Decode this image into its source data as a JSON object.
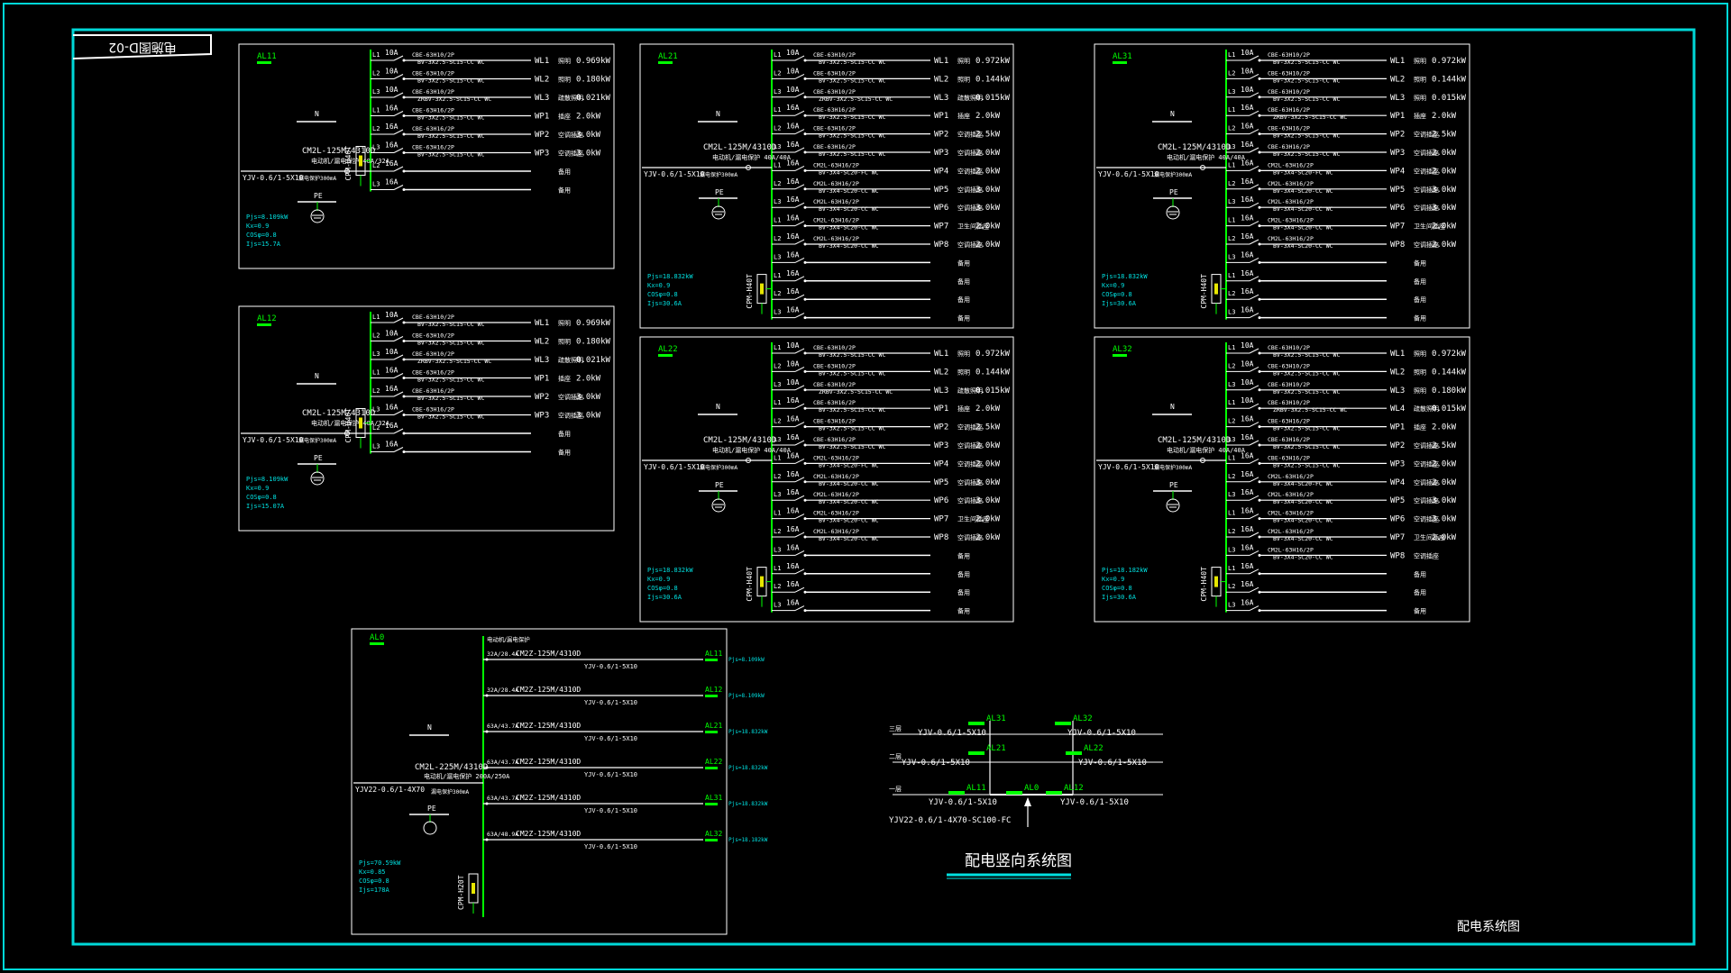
{
  "drawing_id": "电施图D-02",
  "sheet_name": "配电系统图",
  "riser": {
    "title": "配电竖向系统图",
    "floors": [
      "三层",
      "二层",
      "一层"
    ],
    "top_left": {
      "panel": "AL31",
      "cable": "YJV-0.6/1-5X10"
    },
    "top_right": {
      "panel": "AL32",
      "cable": "YJV-0.6/1-5X10"
    },
    "mid_left": {
      "panel": "AL21",
      "cable": "YJV-0.6/1-5X10"
    },
    "mid_right": {
      "panel": "AL22",
      "cable": "YJV-0.6/1-5X10"
    },
    "bot_left": {
      "panel": "AL11",
      "cable": "YJV-0.6/1-5X10"
    },
    "bot_center": {
      "panel": "AL0"
    },
    "bot_right": {
      "panel": "AL12",
      "cable": "YJV-0.6/1-5X10"
    },
    "incoming": "YJV22-0.6/1-4X70-SC100-FC"
  },
  "al0": {
    "name": "AL0",
    "n_label": "N",
    "pe_label": "PE",
    "main_breaker": "CM2L-225M/4310D",
    "main_breaker_spec": "电动机/漏电保护 200A/250A",
    "incoming": "YJV22-0.6/1-4X70",
    "rcd": "漏电保护300mA",
    "spd": "CPM-H20T",
    "pjs": "Pjs=70.59kW",
    "kx": "Kx=0.85",
    "cos": "COSφ=0.8",
    "ijs": "Ijs=178A",
    "header": "电动机/漏电保护",
    "rows": [
      {
        "rating": "32A/28.4A",
        "breaker": "CM2Z-125M/4310D",
        "cable": "YJV-0.6/1-5X10",
        "panel": "AL11",
        "pjs": "Pjs=8.109kW"
      },
      {
        "rating": "32A/28.4A",
        "breaker": "CM2Z-125M/4310D",
        "cable": "YJV-0.6/1-5X10",
        "panel": "AL12",
        "pjs": "Pjs=8.109kW"
      },
      {
        "rating": "63A/43.7A",
        "breaker": "CM2Z-125M/4310D",
        "cable": "YJV-0.6/1-5X10",
        "panel": "AL21",
        "pjs": "Pjs=18.832kW"
      },
      {
        "rating": "63A/43.7A",
        "breaker": "CM2Z-125M/4310D",
        "cable": "YJV-0.6/1-5X10",
        "panel": "AL22",
        "pjs": "Pjs=18.832kW"
      },
      {
        "rating": "63A/43.7A",
        "breaker": "CM2Z-125M/4310D",
        "cable": "YJV-0.6/1-5X10",
        "panel": "AL31",
        "pjs": "Pjs=18.832kW"
      },
      {
        "rating": "63A/48.9A",
        "breaker": "CM2Z-125M/4310D",
        "cable": "YJV-0.6/1-5X10",
        "panel": "AL32",
        "pjs": "Pjs=18.182kW"
      }
    ]
  },
  "panels": [
    {
      "name": "AL11",
      "n_label": "N",
      "pe_label": "PE",
      "main_breaker": "CM2L-125M/4310D",
      "main_breaker_spec": "电动机/漏电保护 40A/32A",
      "incoming": "YJV-0.6/1-5X10",
      "rcd": "漏电保护300mA",
      "spd": "CPM-H40T",
      "pjs": "Pjs=8.109kW",
      "kx": "Kx=0.9",
      "cos": "COSφ=0.8",
      "ijs": "Ijs=15.7A",
      "circuits": [
        {
          "ph": "L1",
          "amp": "10A",
          "brk": "CBE-63H10/2P",
          "cable": "BV-3X2.5-SC15-CC WC",
          "id": "WL1",
          "use": "照明",
          "kw": "0.969kW"
        },
        {
          "ph": "L2",
          "amp": "10A",
          "brk": "CBE-63H10/2P",
          "cable": "BV-3X2.5-SC15-CC WC",
          "id": "WL2",
          "use": "照明",
          "kw": "0.180kW"
        },
        {
          "ph": "L3",
          "amp": "10A",
          "brk": "CBE-63H10/2P",
          "cable": "ZRBV-3X2.5-SC15-CC WC",
          "id": "WL3",
          "use": "疏散照明",
          "kw": "0.021kW"
        },
        {
          "ph": "L1",
          "amp": "16A",
          "brk": "CBE-63H16/2P",
          "cable": "BV-3X2.5-SC15-CC WC",
          "id": "WP1",
          "use": "插座",
          "kw": "2.0kW"
        },
        {
          "ph": "L2",
          "amp": "16A",
          "brk": "CBE-63H16/2P",
          "cable": "BV-3X2.5-SC15-CC WC",
          "id": "WP2",
          "use": "空调插座",
          "kw": "3.0kW"
        },
        {
          "ph": "L3",
          "amp": "16A",
          "brk": "CBE-63H16/2P",
          "cable": "BV-3X2.5-SC15-CC WC",
          "id": "WP3",
          "use": "空调插座",
          "kw": "3.0kW"
        },
        {
          "ph": "L2",
          "amp": "16A",
          "brk": "",
          "cable": "",
          "id": "",
          "use": "备用",
          "kw": ""
        },
        {
          "ph": "L3",
          "amp": "16A",
          "brk": "",
          "cable": "",
          "id": "",
          "use": "备用",
          "kw": ""
        }
      ]
    },
    {
      "name": "AL12",
      "n_label": "N",
      "pe_label": "PE",
      "main_breaker": "CM2L-125M/4310D",
      "main_breaker_spec": "电动机/漏电保护 40A/32A",
      "incoming": "YJV-0.6/1-5X10",
      "rcd": "漏电保护300mA",
      "spd": "CPM-H40T",
      "pjs": "Pjs=8.109kW",
      "kx": "Kx=0.9",
      "cos": "COSφ=0.8",
      "ijs": "Ijs=15.07A",
      "circuits": [
        {
          "ph": "L1",
          "amp": "10A",
          "brk": "CBE-63H10/2P",
          "cable": "BV-3X2.5-SC15-CC WC",
          "id": "WL1",
          "use": "照明",
          "kw": "0.969kW"
        },
        {
          "ph": "L2",
          "amp": "10A",
          "brk": "CBE-63H10/2P",
          "cable": "BV-3X2.5-SC15-CC WC",
          "id": "WL2",
          "use": "照明",
          "kw": "0.180kW"
        },
        {
          "ph": "L3",
          "amp": "10A",
          "brk": "CBE-63H10/2P",
          "cable": "ZRBV-3X2.5-SC15-CC WC",
          "id": "WL3",
          "use": "疏散照明",
          "kw": "0.021kW"
        },
        {
          "ph": "L1",
          "amp": "16A",
          "brk": "CBE-63H16/2P",
          "cable": "BV-3X2.5-SC15-CC WC",
          "id": "WP1",
          "use": "插座",
          "kw": "2.0kW"
        },
        {
          "ph": "L2",
          "amp": "16A",
          "brk": "CBE-63H16/2P",
          "cable": "BV-3X2.5-SC15-CC WC",
          "id": "WP2",
          "use": "空调插座",
          "kw": "3.0kW"
        },
        {
          "ph": "L3",
          "amp": "16A",
          "brk": "CBE-63H16/2P",
          "cable": "BV-3X2.5-SC15-CC WC",
          "id": "WP3",
          "use": "空调插座",
          "kw": "3.0kW"
        },
        {
          "ph": "L2",
          "amp": "16A",
          "brk": "",
          "cable": "",
          "id": "",
          "use": "备用",
          "kw": ""
        },
        {
          "ph": "L3",
          "amp": "16A",
          "brk": "",
          "cable": "",
          "id": "",
          "use": "备用",
          "kw": ""
        }
      ]
    },
    {
      "name": "AL21",
      "n_label": "N",
      "pe_label": "PE",
      "main_breaker": "CM2L-125M/4310D",
      "main_breaker_spec": "电动机/漏电保护 40A/40A",
      "incoming": "YJV-0.6/1-5X10",
      "rcd": "漏电保护300mA",
      "spd": "CPM-H40T",
      "pjs": "Pjs=18.832kW",
      "kx": "Kx=0.9",
      "cos": "COSφ=0.8",
      "ijs": "Ijs=30.6A",
      "circuits": [
        {
          "ph": "L1",
          "amp": "10A",
          "brk": "CBE-63H10/2P",
          "cable": "BV-3X2.5-SC15-CC WC",
          "id": "WL1",
          "use": "照明",
          "kw": "0.972kW"
        },
        {
          "ph": "L2",
          "amp": "10A",
          "brk": "CBE-63H10/2P",
          "cable": "BV-3X2.5-SC15-CC WC",
          "id": "WL2",
          "use": "照明",
          "kw": "0.144kW"
        },
        {
          "ph": "L3",
          "amp": "10A",
          "brk": "CBE-63H10/2P",
          "cable": "ZRBV-3X2.5-SC15-CC WC",
          "id": "WL3",
          "use": "疏散照明",
          "kw": "0.015kW"
        },
        {
          "ph": "L1",
          "amp": "16A",
          "brk": "CBE-63H16/2P",
          "cable": "BV-3X2.5-SC15-CC WC",
          "id": "WP1",
          "use": "插座",
          "kw": "2.0kW"
        },
        {
          "ph": "L2",
          "amp": "16A",
          "brk": "CBE-63H16/2P",
          "cable": "BV-3X2.5-SC15-CC WC",
          "id": "WP2",
          "use": "空调插座",
          "kw": "2.5kW"
        },
        {
          "ph": "L3",
          "amp": "16A",
          "brk": "CBE-63H16/2P",
          "cable": "BV-3X2.5-SC15-CC WC",
          "id": "WP3",
          "use": "空调插座",
          "kw": "2.0kW"
        },
        {
          "ph": "L1",
          "amp": "16A",
          "brk": "CM2L-63H16/2P",
          "cable": "BV-3X4-SC20-FC WC",
          "id": "WP4",
          "use": "空调插座",
          "kw": "2.0kW"
        },
        {
          "ph": "L2",
          "amp": "16A",
          "brk": "CM2L-63H16/2P",
          "cable": "BV-3X4-SC20-CC WC",
          "id": "WP5",
          "use": "空调插座",
          "kw": "3.0kW"
        },
        {
          "ph": "L3",
          "amp": "16A",
          "brk": "CM2L-63H16/2P",
          "cable": "BV-3X4-SC20-CC WC",
          "id": "WP6",
          "use": "空调插座",
          "kw": "3.0kW"
        },
        {
          "ph": "L1",
          "amp": "16A",
          "brk": "CM2L-63H16/2P",
          "cable": "BV-3X4-SC20-CC WC",
          "id": "WP7",
          "use": "卫生间插座",
          "kw": "2.0kW"
        },
        {
          "ph": "L2",
          "amp": "16A",
          "brk": "CM2L-63H16/2P",
          "cable": "BV-3X4-SC20-CC WC",
          "id": "WP8",
          "use": "空调插座",
          "kw": "2.0kW"
        },
        {
          "ph": "L3",
          "amp": "16A",
          "brk": "",
          "cable": "",
          "id": "",
          "use": "备用",
          "kw": ""
        },
        {
          "ph": "L1",
          "amp": "16A",
          "brk": "",
          "cable": "",
          "id": "",
          "use": "备用",
          "kw": ""
        },
        {
          "ph": "L2",
          "amp": "16A",
          "brk": "",
          "cable": "",
          "id": "",
          "use": "备用",
          "kw": ""
        },
        {
          "ph": "L3",
          "amp": "16A",
          "brk": "",
          "cable": "",
          "id": "",
          "use": "备用",
          "kw": ""
        }
      ]
    },
    {
      "name": "AL22",
      "n_label": "N",
      "pe_label": "PE",
      "main_breaker": "CM2L-125M/4310D",
      "main_breaker_spec": "电动机/漏电保护 40A/40A",
      "incoming": "YJV-0.6/1-5X10",
      "rcd": "漏电保护300mA",
      "spd": "CPM-H40T",
      "pjs": "Pjs=18.832kW",
      "kx": "Kx=0.9",
      "cos": "COSφ=0.8",
      "ijs": "Ijs=30.6A",
      "circuits": [
        {
          "ph": "L1",
          "amp": "10A",
          "brk": "CBE-63H10/2P",
          "cable": "BV-3X2.5-SC15-CC WC",
          "id": "WL1",
          "use": "照明",
          "kw": "0.972kW"
        },
        {
          "ph": "L2",
          "amp": "10A",
          "brk": "CBE-63H10/2P",
          "cable": "BV-3X2.5-SC15-CC WC",
          "id": "WL2",
          "use": "照明",
          "kw": "0.144kW"
        },
        {
          "ph": "L3",
          "amp": "10A",
          "brk": "CBE-63H10/2P",
          "cable": "ZRBV-3X2.5-SC15-CC WC",
          "id": "WL3",
          "use": "疏散照明",
          "kw": "0.015kW"
        },
        {
          "ph": "L1",
          "amp": "16A",
          "brk": "CBE-63H16/2P",
          "cable": "BV-3X2.5-SC15-CC WC",
          "id": "WP1",
          "use": "插座",
          "kw": "2.0kW"
        },
        {
          "ph": "L2",
          "amp": "16A",
          "brk": "CBE-63H16/2P",
          "cable": "BV-3X2.5-SC15-CC WC",
          "id": "WP2",
          "use": "空调插座",
          "kw": "2.5kW"
        },
        {
          "ph": "L3",
          "amp": "16A",
          "brk": "CBE-63H16/2P",
          "cable": "BV-3X2.5-SC15-CC WC",
          "id": "WP3",
          "use": "空调插座",
          "kw": "2.0kW"
        },
        {
          "ph": "L1",
          "amp": "16A",
          "brk": "CM2L-63H16/2P",
          "cable": "BV-3X4-SC20-FC WC",
          "id": "WP4",
          "use": "空调插座",
          "kw": "2.0kW"
        },
        {
          "ph": "L2",
          "amp": "16A",
          "brk": "CM2L-63H16/2P",
          "cable": "BV-3X4-SC20-CC WC",
          "id": "WP5",
          "use": "空调插座",
          "kw": "3.0kW"
        },
        {
          "ph": "L3",
          "amp": "16A",
          "brk": "CM2L-63H16/2P",
          "cable": "BV-3X4-SC20-CC WC",
          "id": "WP6",
          "use": "空调插座",
          "kw": "3.0kW"
        },
        {
          "ph": "L1",
          "amp": "16A",
          "brk": "CM2L-63H16/2P",
          "cable": "BV-3X4-SC20-CC WC",
          "id": "WP7",
          "use": "卫生间插座",
          "kw": "2.0kW"
        },
        {
          "ph": "L2",
          "amp": "16A",
          "brk": "CM2L-63H16/2P",
          "cable": "BV-3X4-SC20-CC WC",
          "id": "WP8",
          "use": "空调插座",
          "kw": "2.0kW"
        },
        {
          "ph": "L3",
          "amp": "16A",
          "brk": "",
          "cable": "",
          "id": "",
          "use": "备用",
          "kw": ""
        },
        {
          "ph": "L1",
          "amp": "16A",
          "brk": "",
          "cable": "",
          "id": "",
          "use": "备用",
          "kw": ""
        },
        {
          "ph": "L2",
          "amp": "16A",
          "brk": "",
          "cable": "",
          "id": "",
          "use": "备用",
          "kw": ""
        },
        {
          "ph": "L3",
          "amp": "16A",
          "brk": "",
          "cable": "",
          "id": "",
          "use": "备用",
          "kw": ""
        }
      ]
    },
    {
      "name": "AL31",
      "n_label": "N",
      "pe_label": "PE",
      "main_breaker": "CM2L-125M/4310D",
      "main_breaker_spec": "电动机/漏电保护 40A/40A",
      "incoming": "YJV-0.6/1-5X10",
      "rcd": "漏电保护300mA",
      "spd": "CPM-H40T",
      "pjs": "Pjs=18.832kW",
      "kx": "Kx=0.9",
      "cos": "COSφ=0.8",
      "ijs": "Ijs=30.6A",
      "circuits": [
        {
          "ph": "L1",
          "amp": "10A",
          "brk": "CBE-63H10/2P",
          "cable": "BV-3X2.5-SC15-CC WC",
          "id": "WL1",
          "use": "照明",
          "kw": "0.972kW"
        },
        {
          "ph": "L2",
          "amp": "10A",
          "brk": "CBE-63H10/2P",
          "cable": "BV-3X2.5-SC15-CC WC",
          "id": "WL2",
          "use": "照明",
          "kw": "0.144kW"
        },
        {
          "ph": "L3",
          "amp": "10A",
          "brk": "CBE-63H10/2P",
          "cable": "BV-3X2.5-SC15-CC WC",
          "id": "WL3",
          "use": "照明",
          "kw": "0.015kW"
        },
        {
          "ph": "L1",
          "amp": "16A",
          "brk": "CBE-63H16/2P",
          "cable": "ZRBV-3X2.5-SC15-CC WC",
          "id": "WP1",
          "use": "插座",
          "kw": "2.0kW"
        },
        {
          "ph": "L2",
          "amp": "16A",
          "brk": "CBE-63H16/2P",
          "cable": "BV-3X2.5-SC15-CC WC",
          "id": "WP2",
          "use": "空调插座",
          "kw": "2.5kW"
        },
        {
          "ph": "L3",
          "amp": "16A",
          "brk": "CBE-63H16/2P",
          "cable": "BV-3X2.5-SC15-CC WC",
          "id": "WP3",
          "use": "空调插座",
          "kw": "2.0kW"
        },
        {
          "ph": "L1",
          "amp": "16A",
          "brk": "CM2L-63H16/2P",
          "cable": "BV-3X4-SC20-FC WC",
          "id": "WP4",
          "use": "空调插座",
          "kw": "2.0kW"
        },
        {
          "ph": "L2",
          "amp": "16A",
          "brk": "CM2L-63H16/2P",
          "cable": "BV-3X4-SC20-CC WC",
          "id": "WP5",
          "use": "空调插座",
          "kw": "3.0kW"
        },
        {
          "ph": "L3",
          "amp": "16A",
          "brk": "CM2L-63H16/2P",
          "cable": "BV-3X4-SC20-CC WC",
          "id": "WP6",
          "use": "空调插座",
          "kw": "3.0kW"
        },
        {
          "ph": "L1",
          "amp": "16A",
          "brk": "CM2L-63H16/2P",
          "cable": "BV-3X4-SC20-CC WC",
          "id": "WP7",
          "use": "卫生间插座",
          "kw": "2.0kW"
        },
        {
          "ph": "L2",
          "amp": "16A",
          "brk": "CM2L-63H16/2P",
          "cable": "BV-3X4-SC20-CC WC",
          "id": "WP8",
          "use": "空调插座",
          "kw": "2.0kW"
        },
        {
          "ph": "L3",
          "amp": "16A",
          "brk": "",
          "cable": "",
          "id": "",
          "use": "备用",
          "kw": ""
        },
        {
          "ph": "L1",
          "amp": "16A",
          "brk": "",
          "cable": "",
          "id": "",
          "use": "备用",
          "kw": ""
        },
        {
          "ph": "L2",
          "amp": "16A",
          "brk": "",
          "cable": "",
          "id": "",
          "use": "备用",
          "kw": ""
        },
        {
          "ph": "L3",
          "amp": "16A",
          "brk": "",
          "cable": "",
          "id": "",
          "use": "备用",
          "kw": ""
        }
      ]
    },
    {
      "name": "AL32",
      "n_label": "N",
      "pe_label": "PE",
      "main_breaker": "CM2L-125M/4310D",
      "main_breaker_spec": "电动机/漏电保护 40A/40A",
      "incoming": "YJV-0.6/1-5X10",
      "rcd": "漏电保护300mA",
      "spd": "CPM-H40T",
      "pjs": "Pjs=18.182kW",
      "kx": "Kx=0.9",
      "cos": "COSφ=0.8",
      "ijs": "Ijs=30.6A",
      "circuits": [
        {
          "ph": "L1",
          "amp": "10A",
          "brk": "CBE-63H10/2P",
          "cable": "BV-3X2.5-SC15-CC WC",
          "id": "WL1",
          "use": "照明",
          "kw": "0.972kW"
        },
        {
          "ph": "L2",
          "amp": "10A",
          "brk": "CBE-63H10/2P",
          "cable": "BV-3X2.5-SC15-CC WC",
          "id": "WL2",
          "use": "照明",
          "kw": "0.144kW"
        },
        {
          "ph": "L3",
          "amp": "10A",
          "brk": "CBE-63H10/2P",
          "cable": "BV-3X2.5-SC15-CC WC",
          "id": "WL3",
          "use": "照明",
          "kw": "0.180kW"
        },
        {
          "ph": "L1",
          "amp": "10A",
          "brk": "CBE-63H10/2P",
          "cable": "ZRBV-3X2.5-SC15-CC WC",
          "id": "WL4",
          "use": "疏散照明",
          "kw": "0.015kW"
        },
        {
          "ph": "L2",
          "amp": "16A",
          "brk": "CBE-63H16/2P",
          "cable": "BV-3X2.5-SC15-CC WC",
          "id": "WP1",
          "use": "插座",
          "kw": "2.0kW"
        },
        {
          "ph": "L3",
          "amp": "16A",
          "brk": "CBE-63H16/2P",
          "cable": "BV-3X2.5-SC15-CC WC",
          "id": "WP2",
          "use": "空调插座",
          "kw": "2.5kW"
        },
        {
          "ph": "L1",
          "amp": "16A",
          "brk": "CBE-63H16/2P",
          "cable": "BV-3X2.5-SC15-CC WC",
          "id": "WP3",
          "use": "空调插座",
          "kw": "2.0kW"
        },
        {
          "ph": "L2",
          "amp": "16A",
          "brk": "CM2L-63H16/2P",
          "cable": "BV-3X4-SC20-FC WC",
          "id": "WP4",
          "use": "空调插座",
          "kw": "2.0kW"
        },
        {
          "ph": "L3",
          "amp": "16A",
          "brk": "CM2L-63H16/2P",
          "cable": "BV-3X4-SC20-CC WC",
          "id": "WP5",
          "use": "空调插座",
          "kw": "3.0kW"
        },
        {
          "ph": "L1",
          "amp": "16A",
          "brk": "CM2L-63H16/2P",
          "cable": "BV-3X4-SC20-CC WC",
          "id": "WP6",
          "use": "空调插座",
          "kw": "3.0kW"
        },
        {
          "ph": "L2",
          "amp": "16A",
          "brk": "CM2L-63H16/2P",
          "cable": "BV-3X4-SC20-CC WC",
          "id": "WP7",
          "use": "卫生间插座",
          "kw": "2.0kW"
        },
        {
          "ph": "L3",
          "amp": "16A",
          "brk": "CM2L-63H16/2P",
          "cable": "BV-3X4-SC20-CC WC",
          "id": "WP8",
          "use": "空调插座",
          "kw": ""
        },
        {
          "ph": "L1",
          "amp": "16A",
          "brk": "",
          "cable": "",
          "id": "",
          "use": "备用",
          "kw": ""
        },
        {
          "ph": "L2",
          "amp": "16A",
          "brk": "",
          "cable": "",
          "id": "",
          "use": "备用",
          "kw": ""
        },
        {
          "ph": "L3",
          "amp": "16A",
          "brk": "",
          "cable": "",
          "id": "",
          "use": "备用",
          "kw": ""
        }
      ]
    }
  ]
}
